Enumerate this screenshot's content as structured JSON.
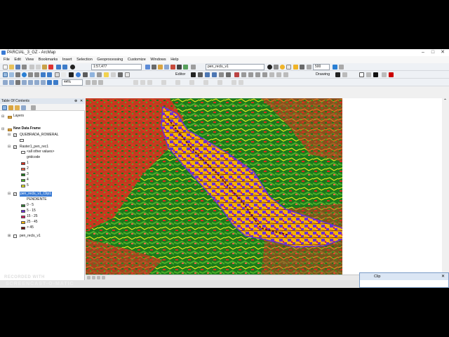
{
  "window": {
    "title": "PARCIAL_3_GZ - ArcMap",
    "min": "–",
    "max": "□",
    "close": "✕"
  },
  "menu": [
    "File",
    "Edit",
    "View",
    "Bookmarks",
    "Insert",
    "Selection",
    "Geoprocessing",
    "Customize",
    "Windows",
    "Help"
  ],
  "toolbar": {
    "scale": "1:57,477",
    "editor_label": "Editor",
    "layer_select": "pen_recls_v1",
    "resolution": "500",
    "drawing_label": "Drawing",
    "zoom_level": "44%"
  },
  "toc": {
    "header": "Table Of Contents",
    "items": {
      "layers": "Layers",
      "data_frame": "New Data Frame",
      "quebrada": "QUEBRADA_ROMERAL",
      "raster": "Raster1_pen_rec1",
      "all_other": "<all other values>",
      "gridcode": "gridcode",
      "g1": "1",
      "g2": "2",
      "g3": "3",
      "g4": "4",
      "g5": "5",
      "clip_layer": "pen_recls_v1_Clip1",
      "pendiente": "PENDIENTE",
      "p1": "0 - 5",
      "p2": "5 - 15",
      "p3": "15 - 25",
      "p4": "25 - 45",
      "p5": "> 45",
      "recls": "pen_recls_v1"
    },
    "colors": {
      "g1": "#d7301f",
      "g2": "#ef6548",
      "g3": "#1b7a1b",
      "g4": "#4caf2a",
      "g5": "#e6e61f",
      "p1": "#2e7d32",
      "p2": "#6a2fd8",
      "p3": "#d81b60",
      "p4": "#f4b400",
      "p5": "#6d1010"
    }
  },
  "clip_window": {
    "title": "Clip"
  },
  "watermark": {
    "line1": "RECORDED WITH",
    "line2": "SCREENCAST-O-MATIC"
  }
}
